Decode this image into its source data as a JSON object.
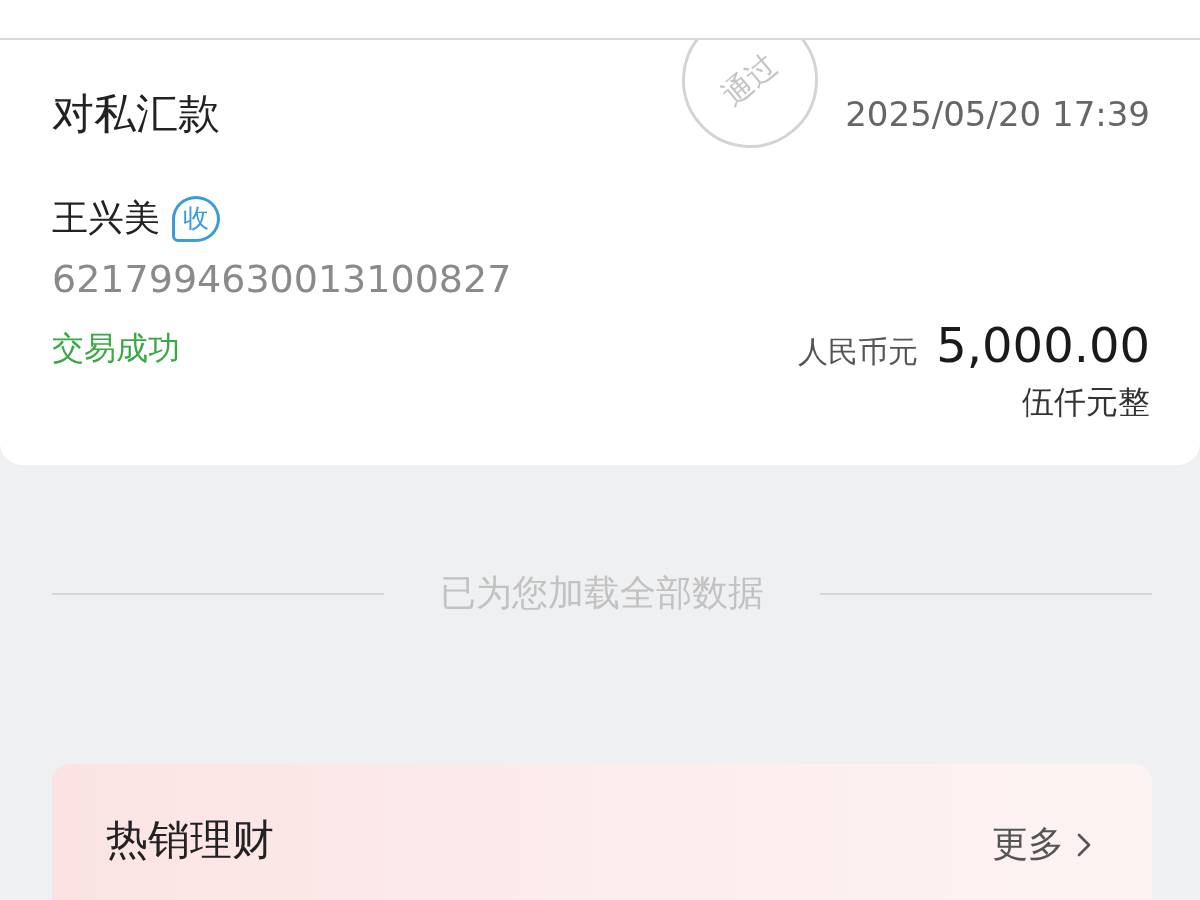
{
  "transaction": {
    "type": "对私汇款",
    "time": "2025/05/20 17:39",
    "stamp": "通过",
    "payee": "王兴美",
    "payee_badge": "收",
    "account": "6217994630013100827",
    "status": "交易成功",
    "currency": "人民币元",
    "amount": "5,000.00",
    "amount_words": "伍仟元整"
  },
  "footer_note": "已为您加载全部数据",
  "promo": {
    "title": "热销理财",
    "more": "更多"
  }
}
